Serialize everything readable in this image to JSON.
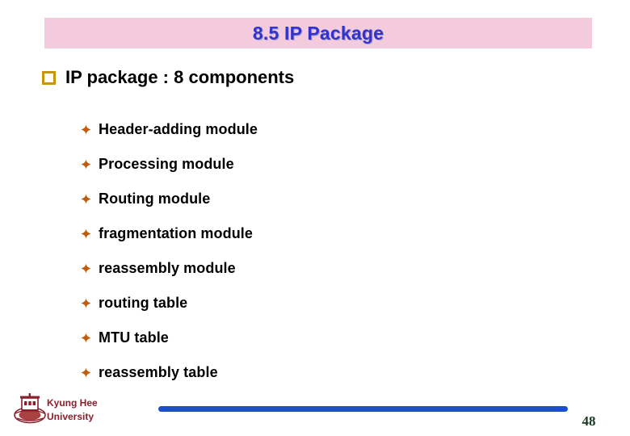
{
  "slide": {
    "title": "8.5 IP Package",
    "title_color": "#3333CC",
    "banner_color": "#F4CBDD"
  },
  "content": {
    "level1": {
      "bullet_icon": "hollow-square-bullet",
      "text": "IP package : 8 components"
    },
    "level2_bullet_icon": "diamond-bullet",
    "level2_items": [
      {
        "label": "Header-adding module"
      },
      {
        "label": "Processing module"
      },
      {
        "label": "Routing module"
      },
      {
        "label": "fragmentation module"
      },
      {
        "label": "reassembly module"
      },
      {
        "label": "routing table"
      },
      {
        "label": "MTU table"
      },
      {
        "label": "reassembly table"
      }
    ]
  },
  "footer": {
    "logo_icon": "kyung-hee-university-crest",
    "org_line1": "Kyung Hee",
    "org_line2": "University",
    "org_color": "#8B1F2B",
    "rule_color": "#1A4ECB",
    "page_number": "48"
  }
}
